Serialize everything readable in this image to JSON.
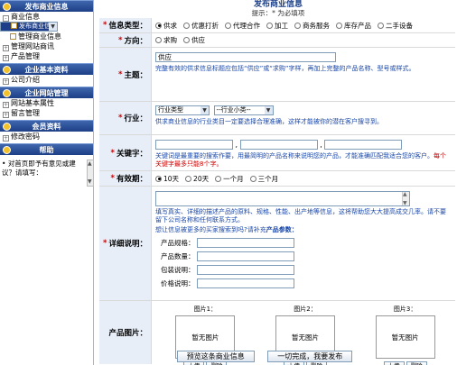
{
  "sidebar": {
    "sections": [
      {
        "title": "发布商业信息",
        "items": [
          {
            "label": "商业信息",
            "level": 0
          },
          {
            "label": "发布商业信息",
            "level": 1,
            "selected": true
          },
          {
            "label": "管理商业信息",
            "level": 1
          },
          {
            "label": "管理网站商讯",
            "level": 0
          },
          {
            "label": "产品管理",
            "level": 0
          }
        ]
      },
      {
        "title": "企业基本资料",
        "items": [
          {
            "label": "公司介绍",
            "level": 0
          }
        ]
      },
      {
        "title": "企业网站管理",
        "items": [
          {
            "label": "网站基本属性",
            "level": 0
          },
          {
            "label": "留言管理",
            "level": 0
          }
        ]
      },
      {
        "title": "会员资料",
        "items": [
          {
            "label": "修改密码",
            "level": 0
          }
        ]
      },
      {
        "title": "帮助",
        "items": []
      }
    ],
    "suggestion_text": "对首页即予有意见或建议？请填写："
  },
  "page": {
    "title": "发布商业信息",
    "note": "提示：* 为必填项"
  },
  "form": {
    "type": {
      "label": "信息类型：",
      "options": [
        "供求",
        "优惠打折",
        "代理合作",
        "加工",
        "商务服务",
        "库存产品",
        "二手设备"
      ],
      "selected": "供求"
    },
    "direction": {
      "label": "方向：",
      "options": [
        "求购",
        "供应"
      ],
      "selected": ""
    },
    "subject": {
      "label": "主题：",
      "value": "供应",
      "hint": "完整有效的供求信息标题应包括“供应”或“求购”字样，再加上完整的产品名称、型号或样式。"
    },
    "industry": {
      "label": "行业：",
      "select1": "行业类型",
      "select2": "--行业小类--",
      "hint": "供求商业信息的行业类目一定要选择合理准确，这样才能被你的潜在客户搜寻到。"
    },
    "keywords": {
      "label": "关键字：",
      "separator": ",",
      "hint": "关键词是最重要的搜索作要，用最简明的产品名称来说明您的产品，才能准确匹配我适合您的客户。",
      "hint_red": "每个关键字最多只能8个字。"
    },
    "validity": {
      "label": "有效期：",
      "options": [
        "10天",
        "20天",
        "一个月",
        "三个月"
      ],
      "selected": "10天"
    },
    "detail": {
      "label": "详细说明：",
      "hint": "填写真实、详细的描述产品的原料、规格、性能、出产地等信息，这将帮助您大大提高成交几率。请不要留下公司名称和任何联系方式。",
      "hint2_prefix": "想让信息被更多的买家搜索到吗?请补充",
      "hint2_bold": "产品参数：",
      "attributes": [
        {
          "label": "产品规格："
        },
        {
          "label": "产品数量："
        },
        {
          "label": "包装说明："
        },
        {
          "label": "价格说明："
        }
      ]
    },
    "images": {
      "label": "产品图片：",
      "slots": [
        {
          "caption": "图片1：",
          "placeholder": "暂无图片",
          "upload": "上传",
          "delete": "删除"
        },
        {
          "caption": "图片2：",
          "placeholder": "暂无图片",
          "upload": "上传",
          "delete": "删除"
        },
        {
          "caption": "图片3：",
          "placeholder": "暂无图片",
          "upload": "上传",
          "delete": "删除"
        }
      ]
    }
  },
  "buttons": {
    "preview": "预览这条商业信息",
    "submit": "一切完成，我要发布"
  }
}
